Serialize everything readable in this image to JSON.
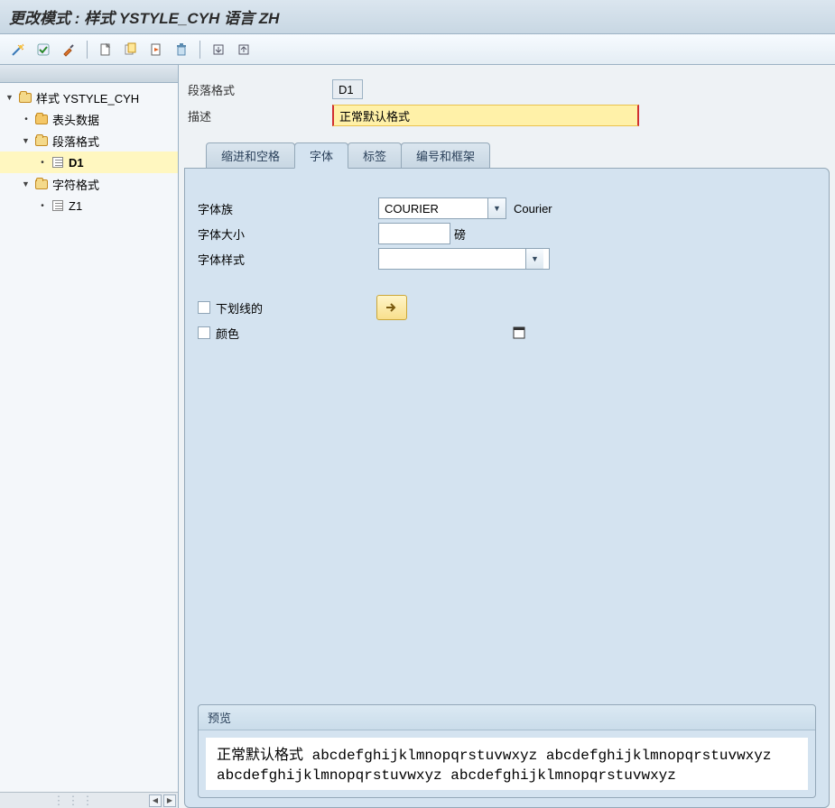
{
  "title": "更改模式 : 样式 YSTYLE_CYH 语言 ZH",
  "toolbar": {
    "icons": [
      "wand-icon",
      "check-icon",
      "brush-icon",
      "new-icon",
      "copy-icon",
      "activate-icon",
      "delete-icon",
      "import-icon",
      "export-icon"
    ]
  },
  "tree": {
    "root": {
      "label": "样式 YSTYLE_CYH",
      "type": "folder-open"
    },
    "nodes": [
      {
        "label": "表头数据",
        "type": "folder-closed",
        "indent": 1,
        "leaf": true
      },
      {
        "label": "段落格式",
        "type": "folder-open",
        "indent": 1
      },
      {
        "label": "D1",
        "type": "node",
        "indent": 2,
        "selected": true,
        "leaf": true
      },
      {
        "label": "字符格式",
        "type": "folder-open",
        "indent": 1
      },
      {
        "label": "Z1",
        "type": "node",
        "indent": 2,
        "leaf": true
      }
    ]
  },
  "form": {
    "para_format_label": "段落格式",
    "para_format_value": "D1",
    "desc_label": "描述",
    "desc_value": "正常默认格式"
  },
  "tabs": [
    "缩进和空格",
    "字体",
    "标签",
    "编号和框架"
  ],
  "active_tab": 1,
  "font": {
    "family_label": "字体族",
    "family_value": "COURIER",
    "family_desc": "Courier",
    "size_label": "字体大小",
    "size_value": "",
    "size_unit": "磅",
    "style_label": "字体样式",
    "style_value": "",
    "underline_label": "下划线的",
    "color_label": "颜色"
  },
  "preview": {
    "title": "预览",
    "text": "正常默认格式 abcdefghijklmnopqrstuvwxyz abcdefghijklmnopqrstuvwxyz abcdefghijklmnopqrstuvwxyz abcdefghijklmnopqrstuvwxyz"
  }
}
